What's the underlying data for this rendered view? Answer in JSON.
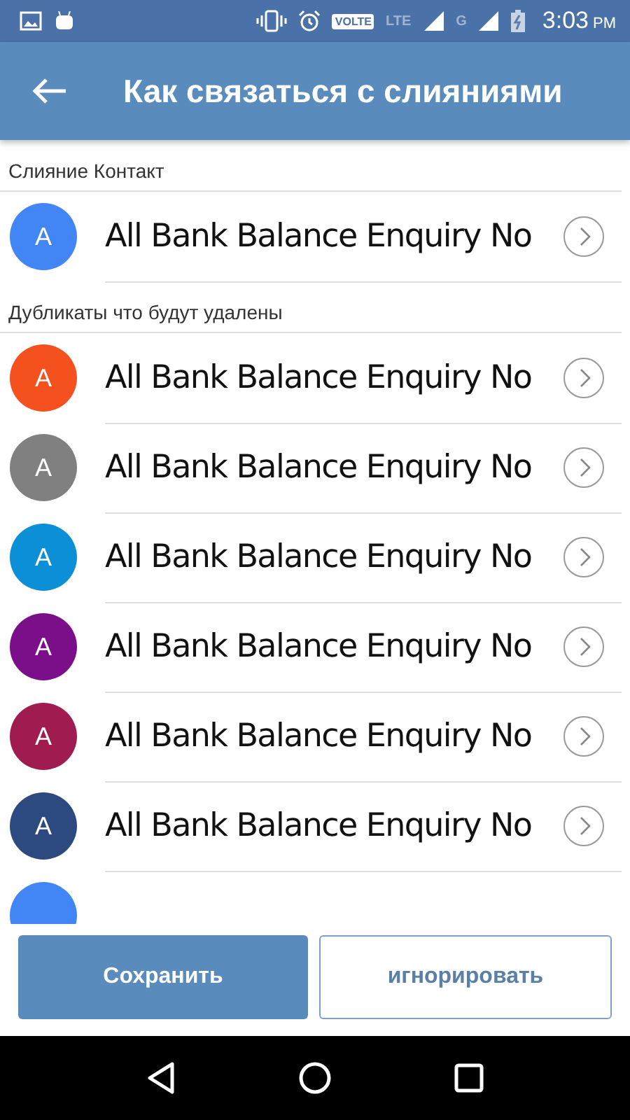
{
  "status_bar": {
    "network_labels": [
      "VOLTE",
      "LTE",
      "G"
    ],
    "time": "3:03",
    "time_suffix": "PM"
  },
  "app_bar": {
    "title": "Как связаться с слияниями"
  },
  "sections": [
    {
      "header": "Слияние Контакт",
      "contacts": [
        {
          "initial": "A",
          "name": "All Bank Balance Enquiry No",
          "color": "#4285f4"
        }
      ]
    },
    {
      "header": "Дубликаты что будут удалены",
      "contacts": [
        {
          "initial": "A",
          "name": "All Bank Balance Enquiry No",
          "color": "#f4511e"
        },
        {
          "initial": "A",
          "name": "All Bank Balance Enquiry No",
          "color": "#808080"
        },
        {
          "initial": "A",
          "name": "All Bank Balance Enquiry No",
          "color": "#0b8fd6"
        },
        {
          "initial": "A",
          "name": "All Bank Balance Enquiry No",
          "color": "#7b0f8a"
        },
        {
          "initial": "A",
          "name": "All Bank Balance Enquiry No",
          "color": "#a01b50"
        },
        {
          "initial": "A",
          "name": "All Bank Balance Enquiry No",
          "color": "#2c4a7f"
        }
      ]
    }
  ],
  "partial_avatar": {
    "color": "#4285f4"
  },
  "buttons": [
    {
      "label": "Сохранить",
      "kind": "primary"
    },
    {
      "label": "игнорировать",
      "kind": "outline"
    }
  ]
}
